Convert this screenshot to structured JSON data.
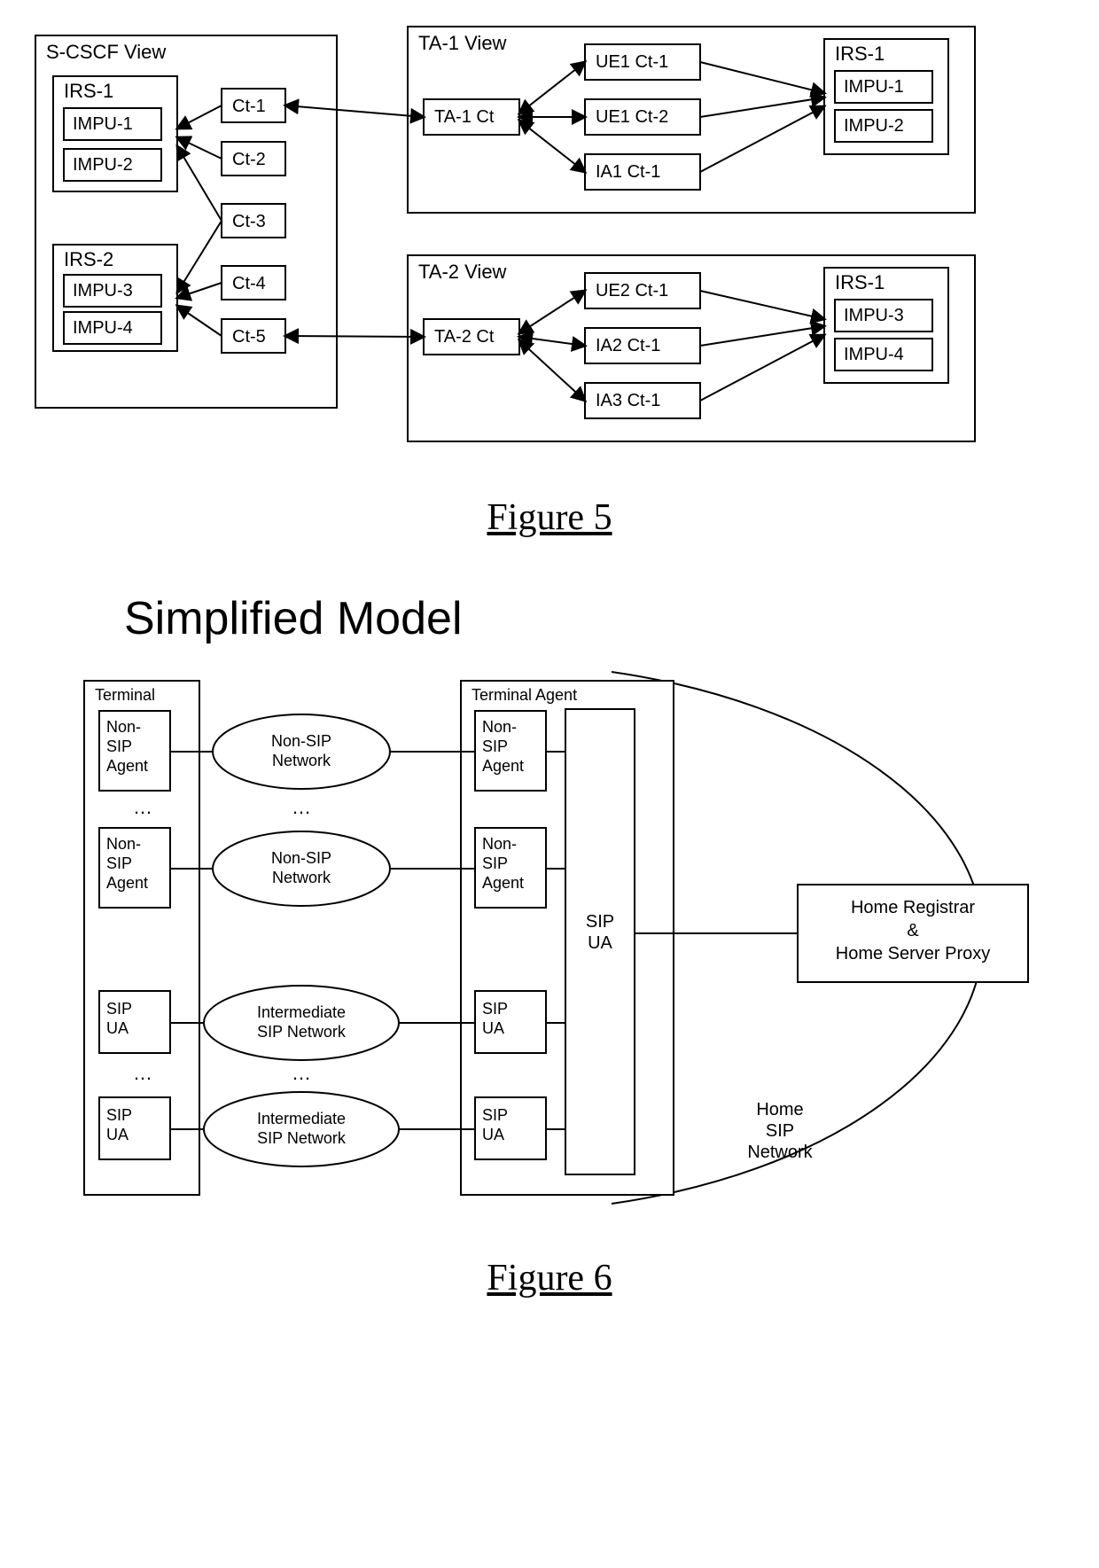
{
  "fig5": {
    "caption": "Figure 5",
    "scscf": {
      "title": "S-CSCF View",
      "irs1": {
        "title": "IRS-1",
        "items": [
          "IMPU-1",
          "IMPU-2"
        ]
      },
      "irs2": {
        "title": "IRS-2",
        "items": [
          "IMPU-3",
          "IMPU-4"
        ]
      },
      "cts": [
        "Ct-1",
        "Ct-2",
        "Ct-3",
        "Ct-4",
        "Ct-5"
      ]
    },
    "ta1": {
      "title": "TA-1 View",
      "ct": "TA-1 Ct",
      "items": [
        "UE1 Ct-1",
        "UE1 Ct-2",
        "IA1 Ct-1"
      ],
      "irs": {
        "title": "IRS-1",
        "items": [
          "IMPU-1",
          "IMPU-2"
        ]
      }
    },
    "ta2": {
      "title": "TA-2 View",
      "ct": "TA-2 Ct",
      "items": [
        "UE2 Ct-1",
        "IA2 Ct-1",
        "IA3 Ct-1"
      ],
      "irs": {
        "title": "IRS-1",
        "items": [
          "IMPU-3",
          "IMPU-4"
        ]
      }
    }
  },
  "fig6": {
    "caption": "Figure 6",
    "title": "Simplified Model",
    "terminal": {
      "title": "Terminal",
      "agents": [
        "Non-\nSIP\nAgent",
        "Non-\nSIP\nAgent",
        "SIP\nUA",
        "SIP\nUA"
      ],
      "ellipsis": "…"
    },
    "networks": [
      "Non-SIP\nNetwork",
      "Non-SIP\nNetwork",
      "Intermediate\nSIP Network",
      "Intermediate\nSIP Network"
    ],
    "terminal_agent": {
      "title": "Terminal Agent",
      "agents": [
        "Non-\nSIP\nAgent",
        "Non-\nSIP\nAgent",
        "SIP\nUA",
        "SIP\nUA"
      ],
      "sip_ua": "SIP\nUA"
    },
    "home": {
      "registrar": "Home Registrar\n&\nHome Server Proxy",
      "network": "Home\nSIP\nNetwork"
    }
  }
}
